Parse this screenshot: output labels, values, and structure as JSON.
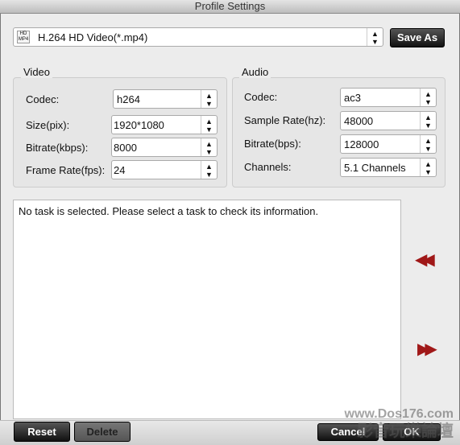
{
  "window": {
    "title": "Profile Settings"
  },
  "profile": {
    "value": "H.264 HD Video(*.mp4)",
    "icon": "hd-mp4-icon",
    "save_as": "Save As"
  },
  "video": {
    "title": "Video",
    "codec_label": "Codec:",
    "codec": "h264",
    "size_label": "Size(pix):",
    "size": "1920*1080",
    "bitrate_label": "Bitrate(kbps):",
    "bitrate": "8000",
    "framerate_label": "Frame Rate(fps):",
    "framerate": "24"
  },
  "audio": {
    "title": "Audio",
    "codec_label": "Codec:",
    "codec": "ac3",
    "samplerate_label": "Sample Rate(hz):",
    "samplerate": "48000",
    "bitrate_label": "Bitrate(bps):",
    "bitrate": "128000",
    "channels_label": "Channels:",
    "channels": "5.1 Channels"
  },
  "info": {
    "text": "No task is selected. Please select a task to check its information."
  },
  "buttons": {
    "reset": "Reset",
    "delete": "Delete",
    "cancel": "Cancel",
    "ok": "OK"
  },
  "watermark": {
    "line1": "www.Dos176.com",
    "line2": "影音玩樂論壇"
  },
  "colors": {
    "arrow": "#a01818"
  }
}
